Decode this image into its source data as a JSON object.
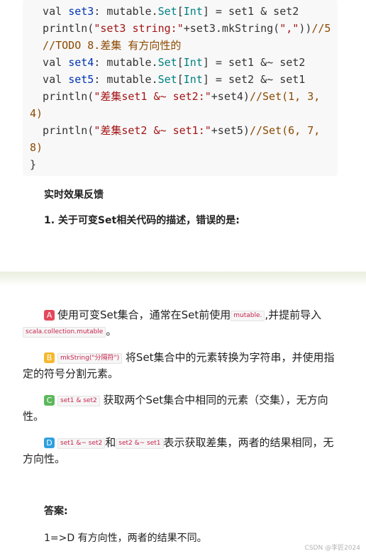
{
  "code": {
    "line1": {
      "p1": "  val ",
      "p2": "set3",
      "p3": ": mutable.",
      "p4": "Set",
      "p5": "[",
      "p6": "Int",
      "p7": "] = set1 & set2"
    },
    "line2": {
      "p1": "  println(",
      "p2": "\"set3 string:\"",
      "p3": "+set3.mkString(",
      "p4": "\",\"",
      "p5": "))",
      "p6": "//5"
    },
    "line3": {
      "p1": "  //TODO 8.差集 有方向性的"
    },
    "line4": {
      "p1": "  val ",
      "p2": "set4",
      "p3": ": mutable.",
      "p4": "Set",
      "p5": "[",
      "p6": "Int",
      "p7": "] = set1 &~ set2"
    },
    "line5": {
      "p1": "  val ",
      "p2": "set5",
      "p3": ": mutable.",
      "p4": "Set",
      "p5": "[",
      "p6": "Int",
      "p7": "] = set2 &~ set1"
    },
    "line6": {
      "p1": "  println(",
      "p2": "\"差集set1 &~ set2:\"",
      "p3": "+set4)",
      "p4": "//Set(1, 3,"
    },
    "line7": {
      "p1": "4)"
    },
    "line8": {
      "p1": "  println(",
      "p2": "\"差集set2 &~ set1:\"",
      "p3": "+set5)",
      "p4": "//Set(6, 7,"
    },
    "line9": {
      "p1": "8)"
    },
    "line10": {
      "p1": "}"
    }
  },
  "section_title": "实时效果反馈",
  "question": "1. 关于可变Set相关代码的描述，错误的是:",
  "options": {
    "a": {
      "letter": "A",
      "t1": "使用可变Set集合，通常在Set前使用",
      "chip1": "mutable.",
      "t2": ",并提前导入",
      "chip2": "scala.collection.mutable",
      "t3": "。"
    },
    "b": {
      "letter": "B",
      "chip1": "mkString(\"分隔符\")",
      "t1": "将Set集合中的元素转换为字符串，并使用指定的符号分割元素。"
    },
    "c": {
      "letter": "C",
      "chip1": "set1 & set2",
      "t1": "获取两个Set集合中相同的元素（交集），无方向性。"
    },
    "d": {
      "letter": "D",
      "chip1": "set1 &~ set2",
      "t1": "和",
      "chip2": "set2 &~ set1",
      "t2": "表示获取差集，两者的结果相同，无方向性。"
    }
  },
  "colors": {
    "a": "#e5475b",
    "b": "#f5b82e",
    "c": "#5cb85c",
    "d": "#2e9fe0"
  },
  "answer_title": "答案:",
  "answer": "1=>D 有方向性，两者的结果不同。",
  "watermark": "CSDN @李匠2024"
}
